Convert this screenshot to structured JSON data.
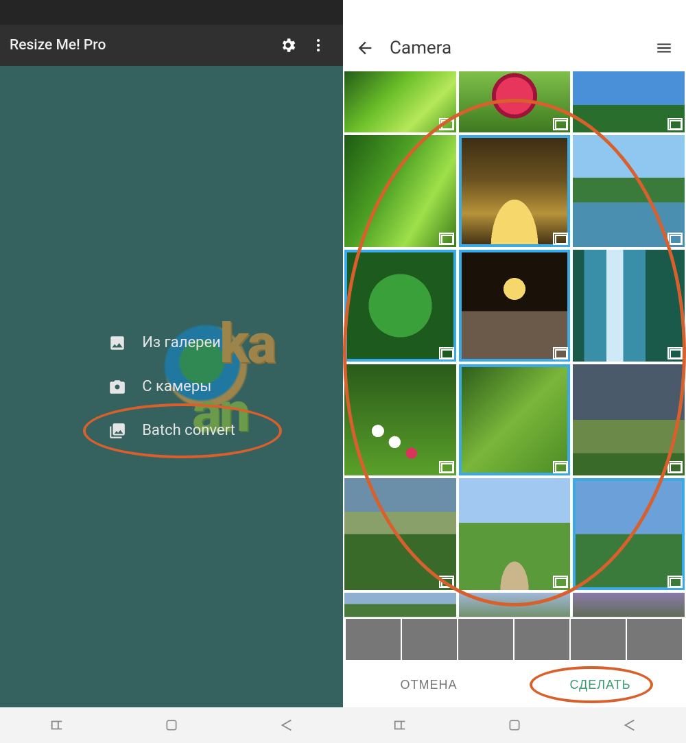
{
  "left": {
    "app_title": "Resize Me! Pro",
    "menu": {
      "gallery": "Из галереи",
      "camera": "С камеры",
      "batch": "Batch convert"
    }
  },
  "right": {
    "header_title": "Camera",
    "thumbs": [
      {
        "name": "grass",
        "css": "bg-grass",
        "selected": false,
        "half": true
      },
      {
        "name": "raspberry",
        "css": "bg-berry",
        "selected": false,
        "half": true
      },
      {
        "name": "sky-field",
        "css": "bg-sky1",
        "selected": false,
        "half": true
      },
      {
        "name": "grass-blades",
        "css": "bg-grass2",
        "selected": false
      },
      {
        "name": "autumn-road",
        "css": "bg-autumn",
        "selected": true
      },
      {
        "name": "lake-mtn",
        "css": "bg-lake",
        "selected": false
      },
      {
        "name": "leaf",
        "css": "bg-leaf",
        "selected": true
      },
      {
        "name": "moonrise",
        "css": "bg-moon",
        "selected": true
      },
      {
        "name": "waterfall",
        "css": "bg-waterfall",
        "selected": false
      },
      {
        "name": "flowers",
        "css": "bg-flowers",
        "selected": false
      },
      {
        "name": "fern",
        "css": "bg-fern",
        "selected": true
      },
      {
        "name": "storm",
        "css": "bg-storm",
        "selected": false
      },
      {
        "name": "valley",
        "css": "bg-valley",
        "selected": false
      },
      {
        "name": "path",
        "css": "bg-path",
        "selected": false
      },
      {
        "name": "bluesel",
        "css": "bg-bluesel",
        "selected": true
      },
      {
        "name": "partial1",
        "css": "bg-partial1",
        "selected": false,
        "stub": true
      },
      {
        "name": "partial2",
        "css": "bg-partial2",
        "selected": false,
        "stub": true
      },
      {
        "name": "partial3",
        "css": "bg-partial3",
        "selected": false,
        "stub": true
      }
    ],
    "strip": [
      "bg-autumn",
      "bg-moon",
      "bg-leaf",
      "bg-fern",
      "bg-grass2",
      "bg-bluesel"
    ],
    "actions": {
      "cancel": "ОТМЕНА",
      "do": "СДЕЛАТЬ"
    }
  }
}
